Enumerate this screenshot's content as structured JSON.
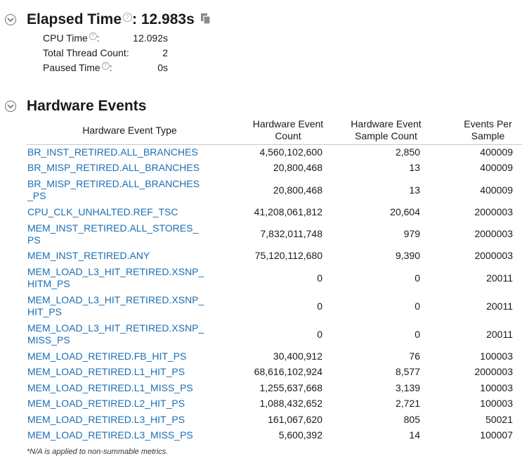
{
  "elapsed": {
    "title": "Elapsed Time",
    "value": ": 12.983s",
    "metrics": [
      {
        "label": "CPU Time",
        "has_help": true,
        "value": "12.092s"
      },
      {
        "label": "Total Thread Count:",
        "has_help": false,
        "value": "2"
      },
      {
        "label": "Paused Time",
        "has_help": true,
        "value": "0s"
      }
    ]
  },
  "hardware": {
    "title": "Hardware Events",
    "columns": [
      "Hardware Event Type",
      "Hardware Event Count",
      "Hardware Event Sample Count",
      "Events Per Sample"
    ],
    "rows": [
      {
        "name": "BR_INST_RETIRED.ALL_BRANCHES",
        "count": "4,560,102,600",
        "samples": "2,850",
        "eps": "400009"
      },
      {
        "name": "BR_MISP_RETIRED.ALL_BRANCHES",
        "count": "20,800,468",
        "samples": "13",
        "eps": "400009"
      },
      {
        "name": "BR_MISP_RETIRED.ALL_BRANCHES\n_PS",
        "count": "20,800,468",
        "samples": "13",
        "eps": "400009"
      },
      {
        "name": "CPU_CLK_UNHALTED.REF_TSC",
        "count": "41,208,061,812",
        "samples": "20,604",
        "eps": "2000003"
      },
      {
        "name": "MEM_INST_RETIRED.ALL_STORES_\nPS",
        "count": "7,832,011,748",
        "samples": "979",
        "eps": "2000003"
      },
      {
        "name": "MEM_INST_RETIRED.ANY",
        "count": "75,120,112,680",
        "samples": "9,390",
        "eps": "2000003"
      },
      {
        "name": "MEM_LOAD_L3_HIT_RETIRED.XSNP_\nHITM_PS",
        "count": "0",
        "samples": "0",
        "eps": "20011"
      },
      {
        "name": "MEM_LOAD_L3_HIT_RETIRED.XSNP_\nHIT_PS",
        "count": "0",
        "samples": "0",
        "eps": "20011"
      },
      {
        "name": "MEM_LOAD_L3_HIT_RETIRED.XSNP_\nMISS_PS",
        "count": "0",
        "samples": "0",
        "eps": "20011"
      },
      {
        "name": "MEM_LOAD_RETIRED.FB_HIT_PS",
        "count": "30,400,912",
        "samples": "76",
        "eps": "100003"
      },
      {
        "name": "MEM_LOAD_RETIRED.L1_HIT_PS",
        "count": "68,616,102,924",
        "samples": "8,577",
        "eps": "2000003"
      },
      {
        "name": "MEM_LOAD_RETIRED.L1_MISS_PS",
        "count": "1,255,637,668",
        "samples": "3,139",
        "eps": "100003"
      },
      {
        "name": "MEM_LOAD_RETIRED.L2_HIT_PS",
        "count": "1,088,432,652",
        "samples": "2,721",
        "eps": "100003"
      },
      {
        "name": "MEM_LOAD_RETIRED.L3_HIT_PS",
        "count": "161,067,620",
        "samples": "805",
        "eps": "50021"
      },
      {
        "name": "MEM_LOAD_RETIRED.L3_MISS_PS",
        "count": "5,600,392",
        "samples": "14",
        "eps": "100007"
      }
    ]
  },
  "footnote": "*N/A is applied to non-summable metrics.",
  "icons": {
    "collapse": "chevron-down-circle-icon",
    "help": "help-icon",
    "copy": "copy-icon"
  },
  "colors": {
    "link": "#1a6fb5",
    "text": "#1a1a1a"
  }
}
